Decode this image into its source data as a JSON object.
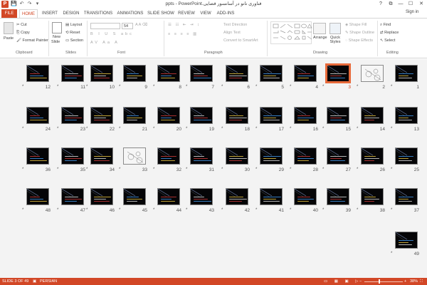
{
  "app": {
    "logo_letter": "P",
    "title": "ppts - PowerPoint.فناوری نانو در آسانسور فضایی"
  },
  "window": {
    "help": "?",
    "restore": "⧉",
    "minimize": "—",
    "maximize": "☐",
    "close": "✕"
  },
  "quick_access": {
    "save": "💾",
    "undo": "↶",
    "redo": "↷",
    "customize": "▾"
  },
  "tabs": [
    "FILE",
    "HOME",
    "INSERT",
    "DESIGN",
    "TRANSITIONS",
    "ANIMATIONS",
    "SLIDE SHOW",
    "REVIEW",
    "VIEW",
    "ADD-INS"
  ],
  "active_tab": "HOME",
  "signin": "Sign in",
  "ribbon": {
    "clipboard": {
      "paste": "Paste",
      "cut": "Cut",
      "copy": "Copy",
      "format_painter": "Format Painter",
      "label": "Clipboard"
    },
    "slides": {
      "new_slide": "New",
      "new_slide2": "Slide",
      "layout": "Layout",
      "reset": "Reset",
      "section": "Section",
      "label": "Slides"
    },
    "font": {
      "font_size": "54",
      "label": "Font"
    },
    "paragraph": {
      "text_direction": "Text Direction",
      "align_text": "Align Text",
      "convert_smartart": "Convert to SmartArt",
      "label": "Paragraph"
    },
    "drawing": {
      "arrange": "Arrange",
      "quick_styles": "Quick Styles",
      "shape_fill": "Shape Fill",
      "shape_outline": "Shape Outline",
      "shape_effects": "Shape Effects",
      "label": "Drawing"
    },
    "editing": {
      "find": "Find",
      "replace": "Replace",
      "select": "Select",
      "label": "Editing"
    }
  },
  "slides": {
    "row1": [
      12,
      11,
      10,
      9,
      8,
      7,
      6,
      5,
      4,
      3,
      2,
      1
    ],
    "row2": [
      24,
      23,
      22,
      21,
      20,
      19,
      18,
      17,
      16,
      15,
      14,
      13
    ],
    "row3": [
      36,
      35,
      34,
      33,
      32,
      31,
      30,
      29,
      28,
      27,
      26,
      25
    ],
    "row4": [
      48,
      47,
      46,
      45,
      44,
      43,
      42,
      41,
      40,
      39,
      38,
      37
    ],
    "row5": [
      49
    ],
    "selected": 3,
    "star": "*"
  },
  "status": {
    "slide_info": "SLIDE 3 OF 49",
    "language": "PERSIAN",
    "zoom": "38%",
    "zoom_minus": "−",
    "zoom_plus": "+"
  },
  "colors": {
    "accent": "#d24726",
    "selection": "#e86a3a",
    "slide_bg": "#050507"
  }
}
